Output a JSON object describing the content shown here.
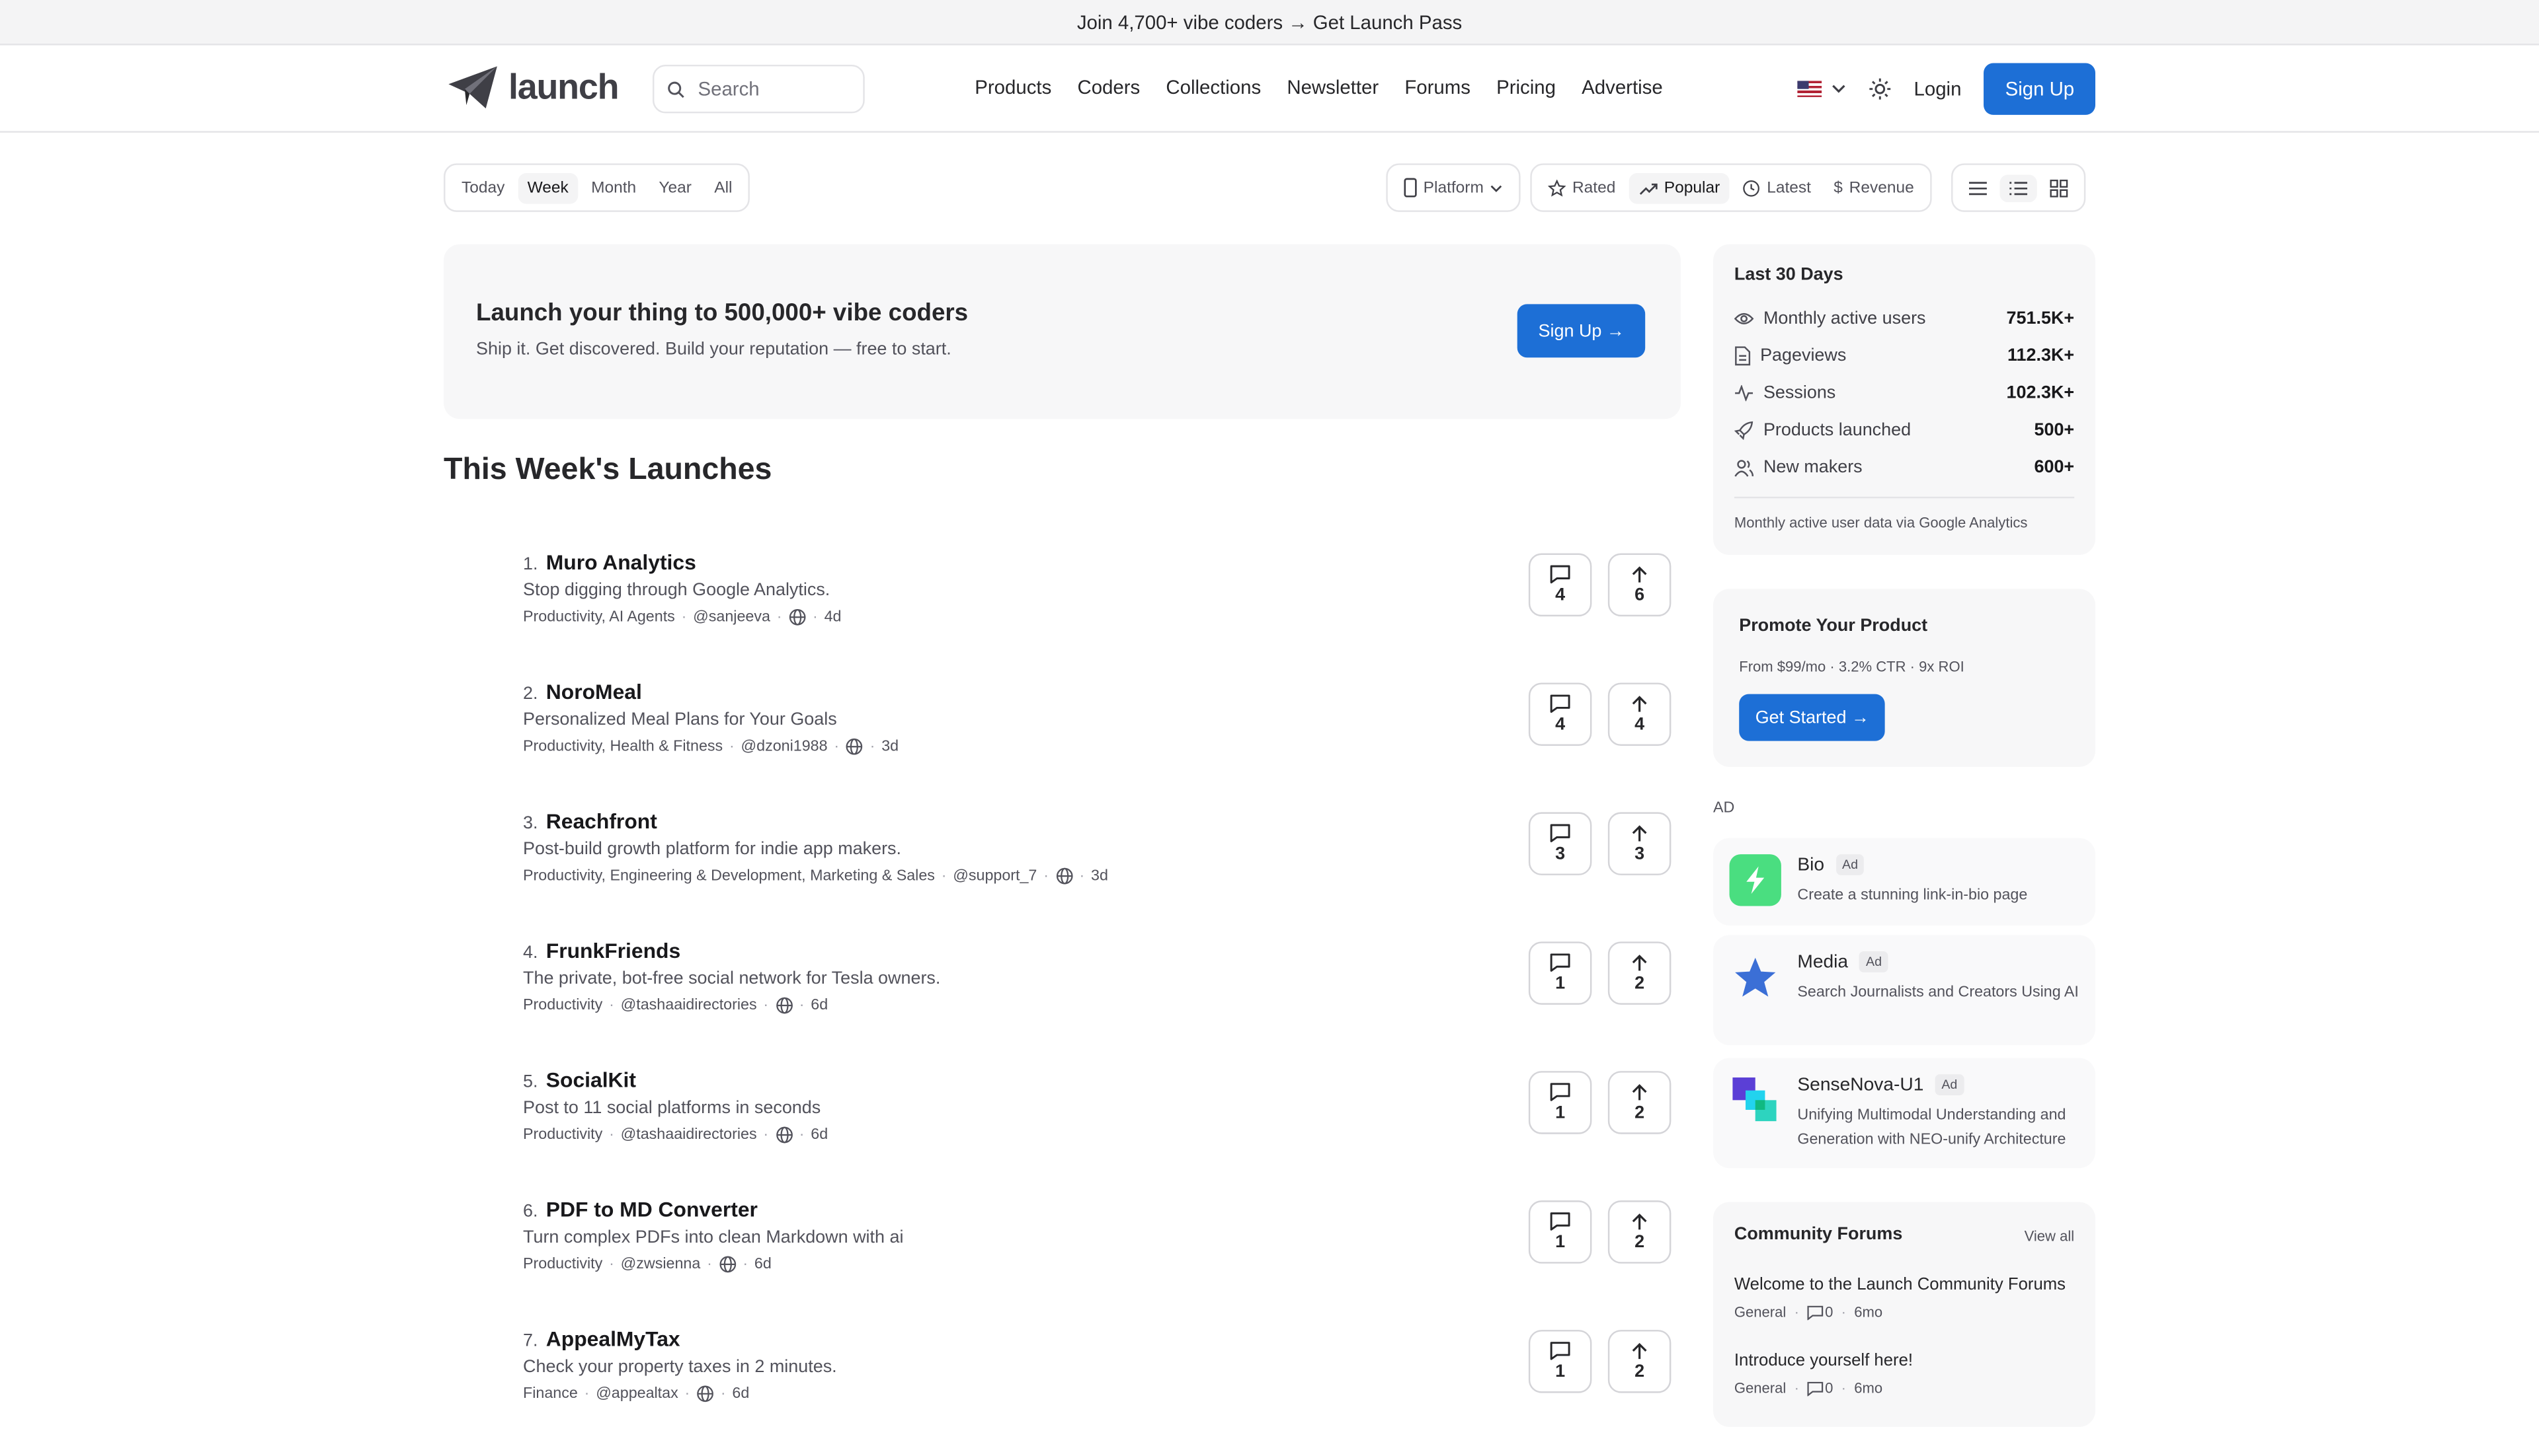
{
  "banner": {
    "text": "Join 4,700+ vibe coders → Get Launch Pass"
  },
  "header": {
    "logo_text": "launch",
    "search_placeholder": "Search",
    "nav": [
      "Products",
      "Coders",
      "Collections",
      "Newsletter",
      "Forums",
      "Pricing",
      "Advertise"
    ],
    "login_label": "Login",
    "signup_label": "Sign Up"
  },
  "filters": {
    "periods": [
      "Today",
      "Week",
      "Month",
      "Year",
      "All"
    ],
    "active_period": "Week",
    "platform_label": "Platform",
    "sorts": [
      "Rated",
      "Popular",
      "Latest",
      "Revenue"
    ],
    "active_sort": "Popular"
  },
  "hero": {
    "title": "Launch your thing to 500,000+ vibe coders",
    "subtitle": "Ship it. Get discovered. Build your reputation — free to start.",
    "button": "Sign Up →"
  },
  "section_title": "This Week's Launches",
  "launches": [
    {
      "rank": "1.",
      "name": "Muro Analytics",
      "tagline": "Stop digging through Google Analytics.",
      "categories": "Productivity,  AI Agents",
      "maker": "@sanjeeva",
      "age": "4d",
      "comments": "4",
      "upvotes": "6"
    },
    {
      "rank": "2.",
      "name": "NoroMeal",
      "tagline": "Personalized Meal Plans for Your Goals",
      "categories": "Productivity,  Health & Fitness",
      "maker": "@dzoni1988",
      "age": "3d",
      "comments": "4",
      "upvotes": "4"
    },
    {
      "rank": "3.",
      "name": "Reachfront",
      "tagline": "Post-build growth platform for indie app makers.",
      "categories": "Productivity,  Engineering & Development,  Marketing & Sales",
      "maker": "@support_7",
      "age": "3d",
      "comments": "3",
      "upvotes": "3"
    },
    {
      "rank": "4.",
      "name": "FrunkFriends",
      "tagline": "The private, bot-free social network for Tesla owners.",
      "categories": "Productivity",
      "maker": "@tashaaidirectories",
      "age": "6d",
      "comments": "1",
      "upvotes": "2"
    },
    {
      "rank": "5.",
      "name": "SocialKit",
      "tagline": "Post to 11 social platforms in seconds",
      "categories": "Productivity",
      "maker": "@tashaaidirectories",
      "age": "6d",
      "comments": "1",
      "upvotes": "2"
    },
    {
      "rank": "6.",
      "name": "PDF to MD Converter",
      "tagline": "Turn complex PDFs into clean Markdown with ai",
      "categories": "Productivity",
      "maker": "@zwsienna",
      "age": "6d",
      "comments": "1",
      "upvotes": "2"
    },
    {
      "rank": "7.",
      "name": "AppealMyTax",
      "tagline": "Check your property taxes in 2 minutes.",
      "categories": "Finance",
      "maker": "@appealtax",
      "age": "6d",
      "comments": "1",
      "upvotes": "2"
    }
  ],
  "stats": {
    "title": "Last 30 Days",
    "rows": [
      {
        "label": "Monthly active users",
        "value": "751.5K+",
        "icon": "eye-icon"
      },
      {
        "label": "Pageviews",
        "value": "112.3K+",
        "icon": "document-icon"
      },
      {
        "label": "Sessions",
        "value": "102.3K+",
        "icon": "activity-icon"
      },
      {
        "label": "Products launched",
        "value": "500+",
        "icon": "rocket-icon"
      },
      {
        "label": "New makers",
        "value": "600+",
        "icon": "users-icon"
      }
    ],
    "note": "Monthly active user data via Google Analytics"
  },
  "promo": {
    "title": "Promote Your Product",
    "subtitle": "From $99/mo · 3.2% CTR · 9x ROI",
    "button": "Get Started →"
  },
  "ads": {
    "label": "AD",
    "badge": "Ad",
    "items": [
      {
        "name": "Bio",
        "desc": "Create a stunning link-in-bio page",
        "icon": "lightning-icon",
        "color": "#4ade80"
      },
      {
        "name": "Media",
        "desc": "Search Journalists and Creators Using AI",
        "icon": "star-icon",
        "color": "#3b6fd6"
      },
      {
        "name": "SenseNova-U1",
        "desc": "Unifying Multimodal Understanding and Generation with NEO-unify Architecture",
        "icon": "squares-icon",
        "color": "#5b3fd6"
      }
    ]
  },
  "forums": {
    "title": "Community Forums",
    "view_all": "View all",
    "topics": [
      {
        "title": "Welcome to the Launch Community Forums",
        "category": "General",
        "replies": "0",
        "age": "6mo"
      },
      {
        "title": "Introduce yourself here!",
        "category": "General",
        "replies": "0",
        "age": "6mo"
      }
    ]
  }
}
